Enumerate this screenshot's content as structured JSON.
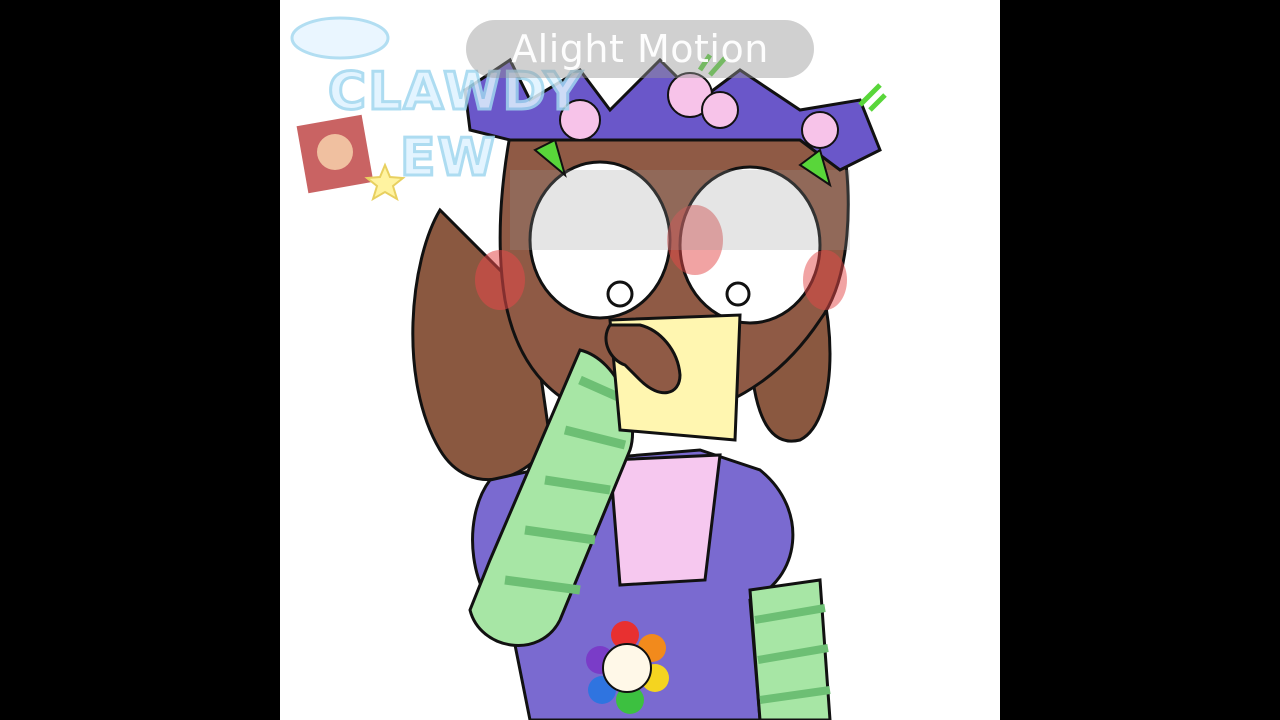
{
  "watermark": {
    "text": "Alight Motion"
  },
  "sticker": {
    "line1": "CLAWDY",
    "line2": "EW"
  },
  "colors": {
    "skin": "#8f5a45",
    "hair": "#8a5840",
    "dress": "#7a6ad0",
    "collar": "#f6c8ef",
    "sleeve_green": "#a7e6a5",
    "sleeve_dark": "#6dbf74",
    "note": "#fff6b0",
    "blush": "#e34848",
    "flower_purple": "#6a57c9",
    "flower_pink": "#f7c3e9",
    "leaf": "#59d63a"
  }
}
